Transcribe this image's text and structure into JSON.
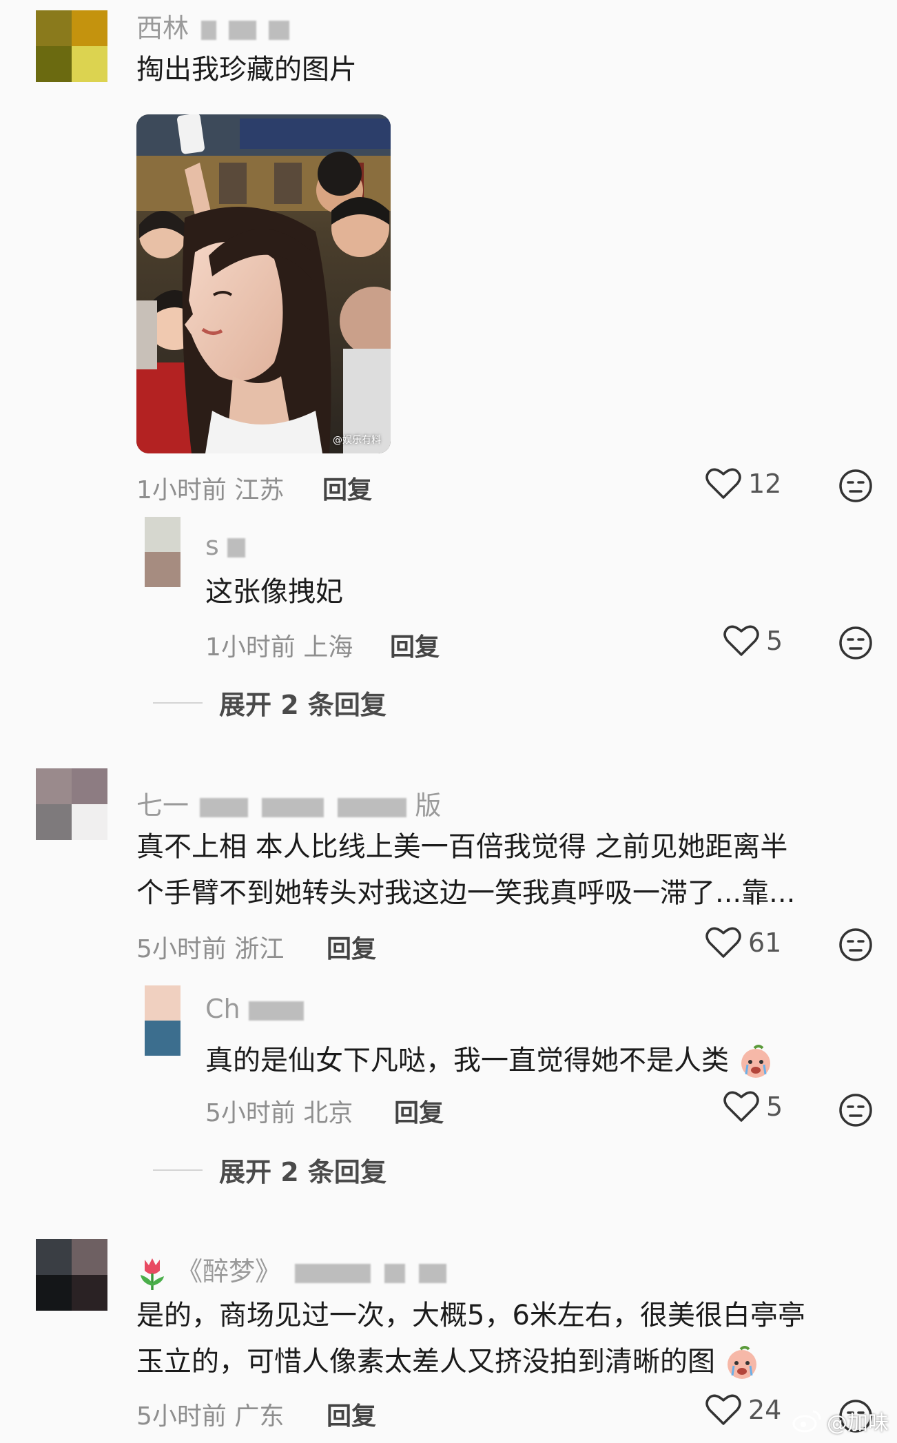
{
  "comments": [
    {
      "username": "西林",
      "text_lines": [
        "掏出我珍藏的图片"
      ],
      "time": "1小时前",
      "location": "江苏",
      "reply_label": "回复",
      "likes": "12",
      "photo_watermark": "@娱乐有料",
      "sub_reply": {
        "username": "s",
        "text": "这张像拽妃",
        "time": "1小时前",
        "location": "上海",
        "reply_label": "回复",
        "likes": "5"
      },
      "expand_label": "展开 2 条回复"
    },
    {
      "username": "七一",
      "username_tail": "版",
      "text_lines": [
        "真不上相 本人比线上美一百倍我觉得 之前见她距离半",
        "个手臂不到她转头对我这边一笑我真呼吸一滞了...靠..."
      ],
      "time": "5小时前",
      "location": "浙江",
      "reply_label": "回复",
      "likes": "61",
      "sub_reply": {
        "username": "Ch",
        "text": "真的是仙女下凡哒，我一直觉得她不是人类",
        "time": "5小时前",
        "location": "北京",
        "reply_label": "回复",
        "likes": "5"
      },
      "expand_label": "展开 2 条回复"
    },
    {
      "username": "《醉梦》",
      "text_lines": [
        "是的，商场见过一次，大概5，6米左右，很美很白亭亭",
        "玉立的，可惜人像素太差人又挤没拍到清晰的图"
      ],
      "time": "5小时前",
      "location": "广东",
      "reply_label": "回复",
      "likes": "24"
    }
  ],
  "footer_watermark": "@加味",
  "colors": {
    "background": "#fafafa",
    "text": "#1b1b1b",
    "meta": "#8e8e8e",
    "username": "#9a9a9a"
  },
  "icons": [
    "heart-icon",
    "dislike-face-icon",
    "tulip-emoji-icon",
    "crying-peach-emoji-icon",
    "weibo-logo-icon"
  ]
}
